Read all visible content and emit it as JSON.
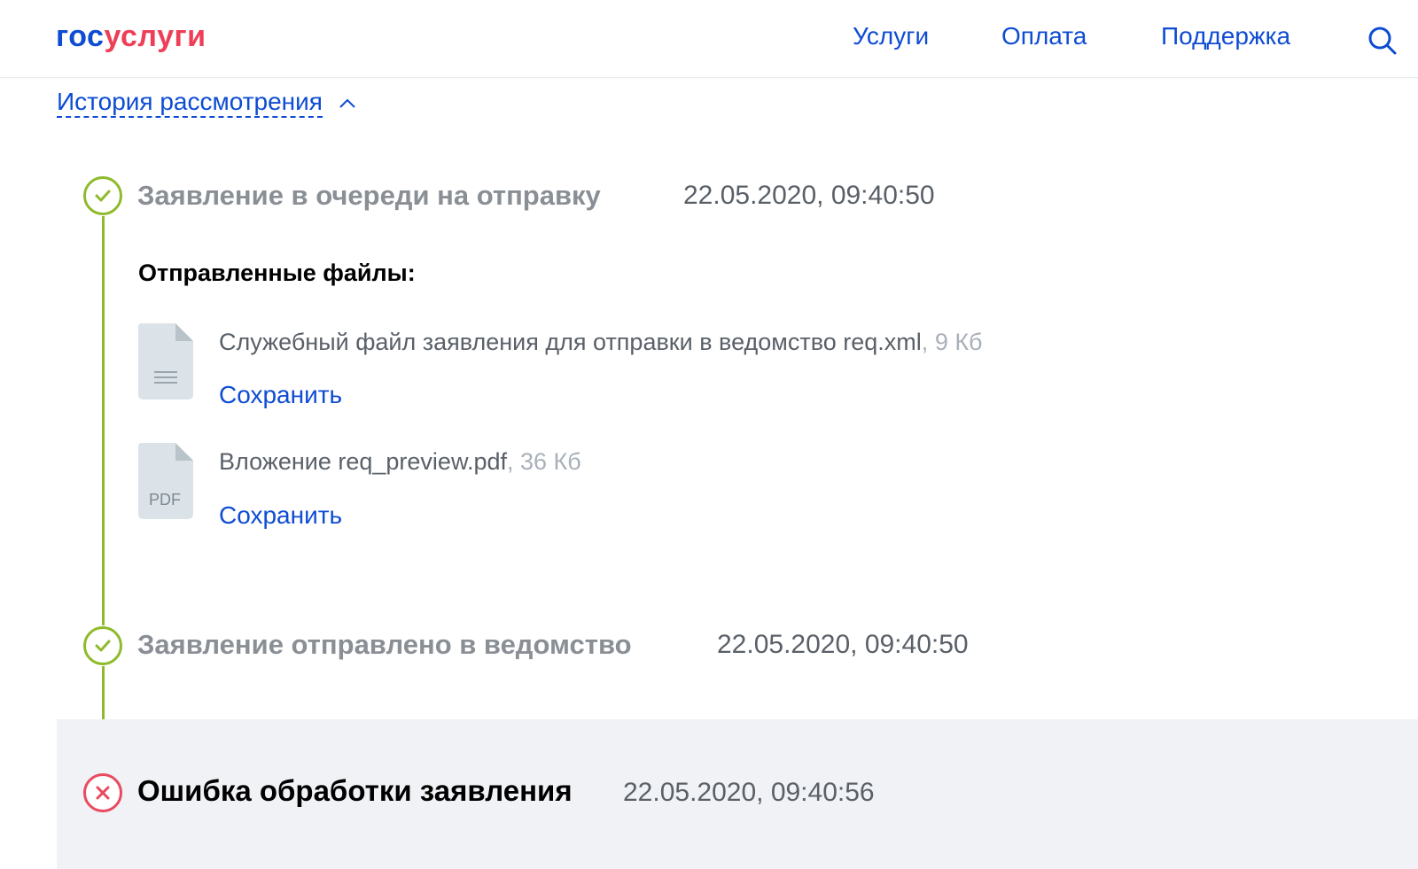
{
  "header": {
    "logo_part1": "гос",
    "logo_part2": "услуги",
    "nav": [
      {
        "label": "Услуги"
      },
      {
        "label": "Оплата"
      },
      {
        "label": "Поддержка"
      }
    ],
    "search_icon": "search-icon"
  },
  "history": {
    "toggle_label": "История рассмотрения",
    "expanded": true
  },
  "events": [
    {
      "status": "success",
      "title": "Заявление в очереди на отправку",
      "time": "22.05.2020, 09:40:50",
      "files_heading": "Отправленные файлы:",
      "files": [
        {
          "icon": "xml-file-icon",
          "name": "Служебный файл заявления для отправки в ведомство req.xml",
          "size": "9 Кб",
          "save_label": "Сохранить"
        },
        {
          "icon": "pdf-file-icon",
          "icon_text": "PDF",
          "name": "Вложение req_preview.pdf",
          "size": "36 Кб",
          "save_label": "Сохранить"
        }
      ]
    },
    {
      "status": "success",
      "title": "Заявление отправлено в ведомство",
      "time": "22.05.2020, 09:40:50"
    },
    {
      "status": "error",
      "title": "Ошибка обработки заявления",
      "time": "22.05.2020, 09:40:56"
    }
  ],
  "colors": {
    "brand_blue": "#0d4cd3",
    "brand_red": "#ee3f58",
    "success_green": "#8fba2c",
    "error_red": "#e84a5f",
    "panel_gray": "#f0f2f5"
  }
}
